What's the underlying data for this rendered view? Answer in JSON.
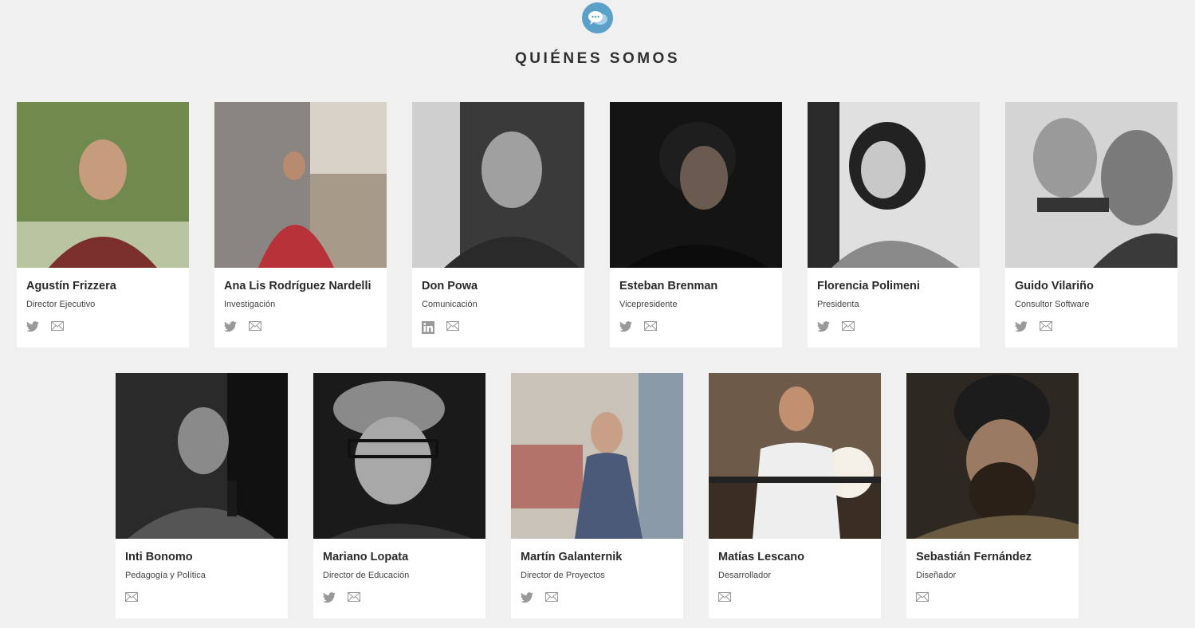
{
  "section": {
    "title": "QUIÉNES SOMOS",
    "icon": "chat-bubbles-icon"
  },
  "team": [
    {
      "name": "Agustín Frizzera",
      "role": "Director Ejecutivo",
      "social": [
        "twitter",
        "email"
      ]
    },
    {
      "name": "Ana Lis Rodríguez Nardelli",
      "role": "Investigación",
      "social": [
        "twitter",
        "email"
      ]
    },
    {
      "name": "Don Powa",
      "role": "Comunicación",
      "social": [
        "linkedin",
        "email"
      ]
    },
    {
      "name": "Esteban Brenman",
      "role": "Vicepresidente",
      "social": [
        "twitter",
        "email"
      ]
    },
    {
      "name": "Florencia Polimeni",
      "role": "Presidenta",
      "social": [
        "twitter",
        "email"
      ]
    },
    {
      "name": "Guido Vilariño",
      "role": "Consultor Software",
      "social": [
        "twitter",
        "email"
      ]
    },
    {
      "name": "Inti Bonomo",
      "role": "Pedagogía y Política",
      "social": [
        "email"
      ]
    },
    {
      "name": "Mariano Lopata",
      "role": "Director de Educación",
      "social": [
        "twitter",
        "email"
      ]
    },
    {
      "name": "Martín Galanternik",
      "role": "Director de Proyectos",
      "social": [
        "twitter",
        "email"
      ]
    },
    {
      "name": "Matías Lescano",
      "role": "Desarrollador",
      "social": [
        "email"
      ]
    },
    {
      "name": "Sebastián Fernández",
      "role": "Diseñador",
      "social": [
        "email"
      ]
    }
  ]
}
